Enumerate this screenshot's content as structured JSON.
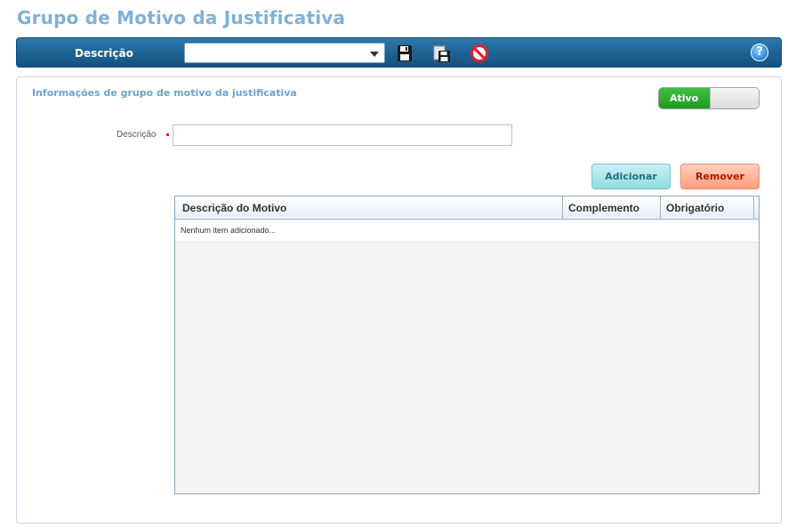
{
  "page": {
    "title": "Grupo de Motivo da Justificativa"
  },
  "toolbar": {
    "label": "Descrição",
    "select_value": "",
    "icons": [
      "save-icon",
      "save-copy-icon",
      "cancel-icon",
      "help-icon"
    ],
    "help_glyph": "?"
  },
  "section": {
    "title": "Informações de grupo de motivo da justificativa",
    "status_label": "Ativo"
  },
  "form": {
    "descricao_label": "Descrição",
    "descricao_value": ""
  },
  "buttons": {
    "add_label": "Adicionar",
    "remove_label": "Remover"
  },
  "grid": {
    "columns": [
      "Descrição do Motivo",
      "Complemento",
      "Obrigatório"
    ],
    "empty_message": "Nenhum item adicionado..."
  },
  "colors": {
    "title": "#7fb1d6",
    "toolbar": "#1f6395",
    "toggle_on": "#1f9a1f",
    "add_button": "#8fdde2",
    "remove_button": "#ff9d7f"
  }
}
